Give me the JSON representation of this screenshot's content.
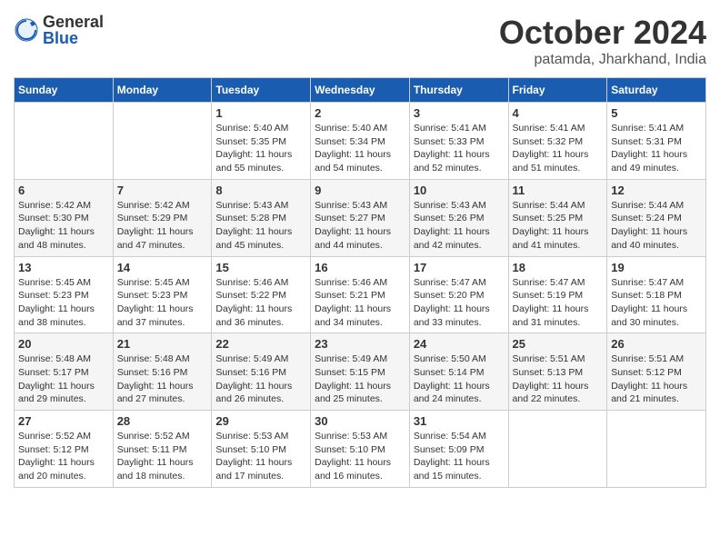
{
  "logo": {
    "general": "General",
    "blue": "Blue"
  },
  "title": "October 2024",
  "location": "patamda, Jharkhand, India",
  "days_header": [
    "Sunday",
    "Monday",
    "Tuesday",
    "Wednesday",
    "Thursday",
    "Friday",
    "Saturday"
  ],
  "weeks": [
    [
      {
        "day": "",
        "info": ""
      },
      {
        "day": "",
        "info": ""
      },
      {
        "day": "1",
        "info": "Sunrise: 5:40 AM\nSunset: 5:35 PM\nDaylight: 11 hours and 55 minutes."
      },
      {
        "day": "2",
        "info": "Sunrise: 5:40 AM\nSunset: 5:34 PM\nDaylight: 11 hours and 54 minutes."
      },
      {
        "day": "3",
        "info": "Sunrise: 5:41 AM\nSunset: 5:33 PM\nDaylight: 11 hours and 52 minutes."
      },
      {
        "day": "4",
        "info": "Sunrise: 5:41 AM\nSunset: 5:32 PM\nDaylight: 11 hours and 51 minutes."
      },
      {
        "day": "5",
        "info": "Sunrise: 5:41 AM\nSunset: 5:31 PM\nDaylight: 11 hours and 49 minutes."
      }
    ],
    [
      {
        "day": "6",
        "info": "Sunrise: 5:42 AM\nSunset: 5:30 PM\nDaylight: 11 hours and 48 minutes."
      },
      {
        "day": "7",
        "info": "Sunrise: 5:42 AM\nSunset: 5:29 PM\nDaylight: 11 hours and 47 minutes."
      },
      {
        "day": "8",
        "info": "Sunrise: 5:43 AM\nSunset: 5:28 PM\nDaylight: 11 hours and 45 minutes."
      },
      {
        "day": "9",
        "info": "Sunrise: 5:43 AM\nSunset: 5:27 PM\nDaylight: 11 hours and 44 minutes."
      },
      {
        "day": "10",
        "info": "Sunrise: 5:43 AM\nSunset: 5:26 PM\nDaylight: 11 hours and 42 minutes."
      },
      {
        "day": "11",
        "info": "Sunrise: 5:44 AM\nSunset: 5:25 PM\nDaylight: 11 hours and 41 minutes."
      },
      {
        "day": "12",
        "info": "Sunrise: 5:44 AM\nSunset: 5:24 PM\nDaylight: 11 hours and 40 minutes."
      }
    ],
    [
      {
        "day": "13",
        "info": "Sunrise: 5:45 AM\nSunset: 5:23 PM\nDaylight: 11 hours and 38 minutes."
      },
      {
        "day": "14",
        "info": "Sunrise: 5:45 AM\nSunset: 5:23 PM\nDaylight: 11 hours and 37 minutes."
      },
      {
        "day": "15",
        "info": "Sunrise: 5:46 AM\nSunset: 5:22 PM\nDaylight: 11 hours and 36 minutes."
      },
      {
        "day": "16",
        "info": "Sunrise: 5:46 AM\nSunset: 5:21 PM\nDaylight: 11 hours and 34 minutes."
      },
      {
        "day": "17",
        "info": "Sunrise: 5:47 AM\nSunset: 5:20 PM\nDaylight: 11 hours and 33 minutes."
      },
      {
        "day": "18",
        "info": "Sunrise: 5:47 AM\nSunset: 5:19 PM\nDaylight: 11 hours and 31 minutes."
      },
      {
        "day": "19",
        "info": "Sunrise: 5:47 AM\nSunset: 5:18 PM\nDaylight: 11 hours and 30 minutes."
      }
    ],
    [
      {
        "day": "20",
        "info": "Sunrise: 5:48 AM\nSunset: 5:17 PM\nDaylight: 11 hours and 29 minutes."
      },
      {
        "day": "21",
        "info": "Sunrise: 5:48 AM\nSunset: 5:16 PM\nDaylight: 11 hours and 27 minutes."
      },
      {
        "day": "22",
        "info": "Sunrise: 5:49 AM\nSunset: 5:16 PM\nDaylight: 11 hours and 26 minutes."
      },
      {
        "day": "23",
        "info": "Sunrise: 5:49 AM\nSunset: 5:15 PM\nDaylight: 11 hours and 25 minutes."
      },
      {
        "day": "24",
        "info": "Sunrise: 5:50 AM\nSunset: 5:14 PM\nDaylight: 11 hours and 24 minutes."
      },
      {
        "day": "25",
        "info": "Sunrise: 5:51 AM\nSunset: 5:13 PM\nDaylight: 11 hours and 22 minutes."
      },
      {
        "day": "26",
        "info": "Sunrise: 5:51 AM\nSunset: 5:12 PM\nDaylight: 11 hours and 21 minutes."
      }
    ],
    [
      {
        "day": "27",
        "info": "Sunrise: 5:52 AM\nSunset: 5:12 PM\nDaylight: 11 hours and 20 minutes."
      },
      {
        "day": "28",
        "info": "Sunrise: 5:52 AM\nSunset: 5:11 PM\nDaylight: 11 hours and 18 minutes."
      },
      {
        "day": "29",
        "info": "Sunrise: 5:53 AM\nSunset: 5:10 PM\nDaylight: 11 hours and 17 minutes."
      },
      {
        "day": "30",
        "info": "Sunrise: 5:53 AM\nSunset: 5:10 PM\nDaylight: 11 hours and 16 minutes."
      },
      {
        "day": "31",
        "info": "Sunrise: 5:54 AM\nSunset: 5:09 PM\nDaylight: 11 hours and 15 minutes."
      },
      {
        "day": "",
        "info": ""
      },
      {
        "day": "",
        "info": ""
      }
    ]
  ]
}
